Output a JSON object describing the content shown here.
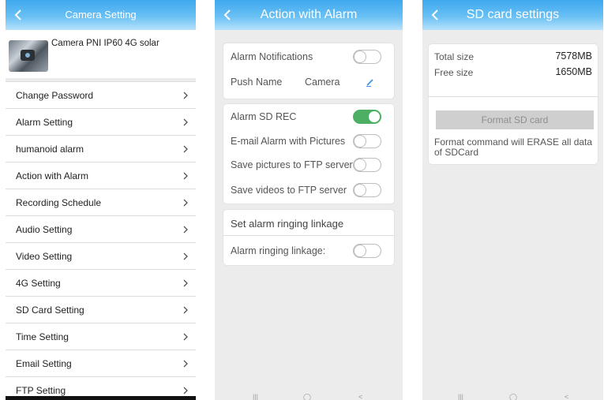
{
  "colors": {
    "header_blue": "#3fa8ee",
    "toggle_on": "#4caf64",
    "background": "#ececec"
  },
  "camera_setting": {
    "title": "Camera Setting",
    "camera_name": "Camera PNI IP60 4G solar",
    "menu": [
      {
        "label": "Change Password"
      },
      {
        "label": "Alarm Setting"
      },
      {
        "label": "humanoid alarm"
      },
      {
        "label": "Action with Alarm"
      },
      {
        "label": "Recording Schedule"
      },
      {
        "label": "Audio Setting"
      },
      {
        "label": "Video Setting"
      },
      {
        "label": "4G Setting"
      },
      {
        "label": "SD Card Setting"
      },
      {
        "label": "Time Setting"
      },
      {
        "label": "Email Setting"
      },
      {
        "label": "FTP Setting"
      }
    ]
  },
  "action_with_alarm": {
    "title": "Action with Alarm",
    "alarm_notifications": {
      "label": "Alarm Notifications",
      "enabled": false
    },
    "push_name": {
      "label": "Push Name",
      "value": "Camera"
    },
    "alarm_sd_rec": {
      "label": "Alarm SD REC",
      "enabled": true
    },
    "email_alarm": {
      "label": "E-mail Alarm with Pictures",
      "enabled": false
    },
    "ftp_pictures": {
      "label": "Save pictures to FTP server",
      "enabled": false
    },
    "ftp_videos": {
      "label": "Save videos to FTP server",
      "enabled": false
    },
    "ringing_section_title": "Set alarm ringing linkage",
    "ringing_linkage": {
      "label": "Alarm ringing linkage:",
      "enabled": false
    }
  },
  "sd_card_settings": {
    "title": "SD card settings",
    "total_size": {
      "label": "Total size",
      "value": "7578MB"
    },
    "free_size": {
      "label": "Free size",
      "value": "1650MB"
    },
    "format_button": "Format SD card",
    "note": "Format command will ERASE all data of SDCard"
  }
}
